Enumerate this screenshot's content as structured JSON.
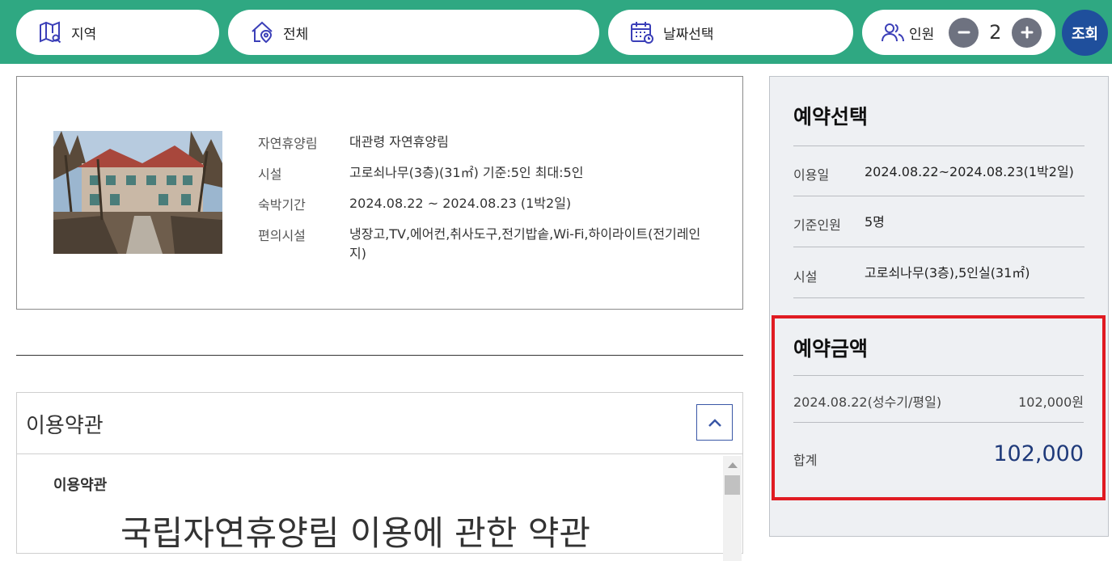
{
  "search_bar": {
    "region": {
      "label": "지역",
      "icon": "map-icon"
    },
    "forest": {
      "label": "전체",
      "icon": "location-pin-icon"
    },
    "date": {
      "label": "날짜선택",
      "icon": "calendar-icon"
    },
    "people": {
      "label": "인원",
      "count": "2",
      "icon": "people-icon"
    },
    "search_label": "조회",
    "colors": {
      "bar": "#2fa882",
      "search_button": "#1f4f9c",
      "stepper": "#6e7280"
    }
  },
  "facility": {
    "rows": [
      {
        "key": "자연휴양림",
        "value": "대관령 자연휴양림"
      },
      {
        "key": "시설",
        "value": "고로쇠나무(3층)(31㎡) 기준:5인 최대:5인"
      },
      {
        "key": "숙박기간",
        "value": "2024.08.22 ~ 2024.08.23 (1박2일)"
      },
      {
        "key": "편의시설",
        "value": "냉장고,TV,에어컨,취사도구,전기밥솥,Wi-Fi,하이라이트(전기레인지)"
      }
    ]
  },
  "terms": {
    "title": "이용약관",
    "subtitle": "이용약관",
    "heading": "국립자연휴양림 이용에 관한 약관"
  },
  "reservation": {
    "title": "예약선택",
    "rows": [
      {
        "key": "이용일",
        "value": "2024.08.22~2024.08.23(1박2일)"
      },
      {
        "key": "기준인원",
        "value": "5명"
      },
      {
        "key": "시설",
        "value": "고로쇠나무(3층),5인실(31㎡)"
      }
    ],
    "amount": {
      "title": "예약금액",
      "line_date": "2024.08.22(성수기/평일)",
      "line_price": "102,000원",
      "total_label": "합계",
      "total_value": "102,000"
    },
    "colors": {
      "highlight_border": "#e01b22",
      "total_text": "#1f3a7a"
    }
  }
}
